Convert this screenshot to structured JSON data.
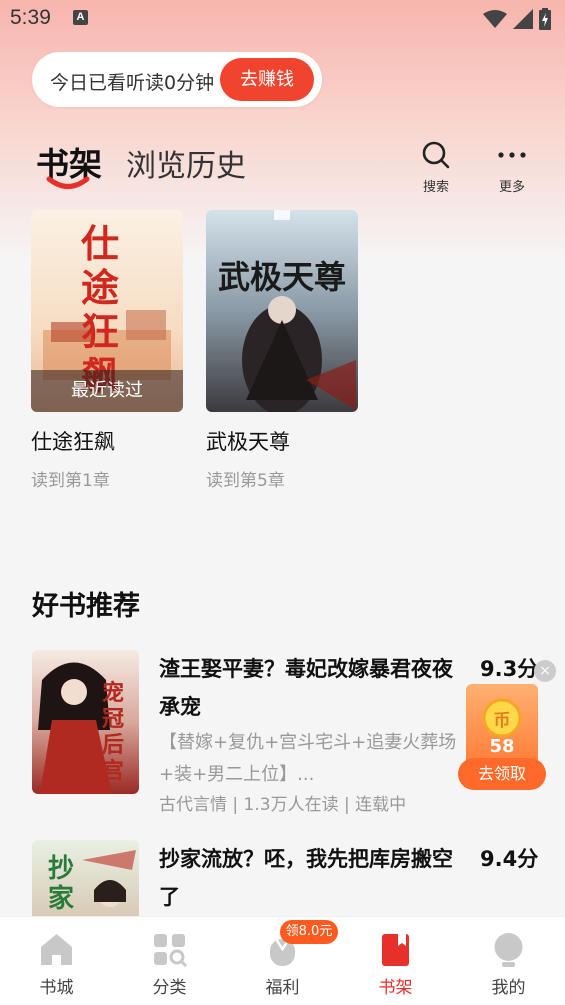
{
  "status": {
    "time": "5:39",
    "notification_icon": "A"
  },
  "earn": {
    "text": "今日已看听读0分钟",
    "button": "去赚钱"
  },
  "header": {
    "tab_shelf": "书架",
    "tab_history": "浏览历史",
    "search_label": "搜索",
    "more_label": "更多"
  },
  "shelf": [
    {
      "title": "仕途狂飙",
      "progress": "读到第1章",
      "badge": "最近读过",
      "cover_text": "仕途狂飙"
    },
    {
      "title": "武极天尊",
      "progress": "读到第5章",
      "cover_text": "武极天尊"
    }
  ],
  "recommend": {
    "heading": "好书推荐",
    "items": [
      {
        "title": "渣王娶平妻？毒妃改嫁暴君夜夜承宠",
        "score": "9.3分",
        "desc": "【替嫁+复仇+宫斗宅斗+追妻火葬场+装+男二上位】...",
        "meta": "古代言情 | 1.3万人在读 | 连载中",
        "cover_text": "宠冠后宫"
      },
      {
        "title": "抄家流放？呸，我先把库房搬空了",
        "score": "9.4分",
        "cover_text": "抄家"
      }
    ]
  },
  "coin": {
    "amount": "58",
    "button": "去领取",
    "close": "×",
    "glyph": "币"
  },
  "nav": {
    "badge": "领8.0元",
    "items": [
      {
        "label": "书城",
        "icon": "home-icon"
      },
      {
        "label": "分类",
        "icon": "category-icon"
      },
      {
        "label": "福利",
        "icon": "welfare-icon"
      },
      {
        "label": "书架",
        "icon": "bookshelf-icon"
      },
      {
        "label": "我的",
        "icon": "profile-icon"
      }
    ]
  },
  "colors": {
    "accent": "#e8302b",
    "earn_button": "#f0442e",
    "coin": "#ff7a35"
  }
}
